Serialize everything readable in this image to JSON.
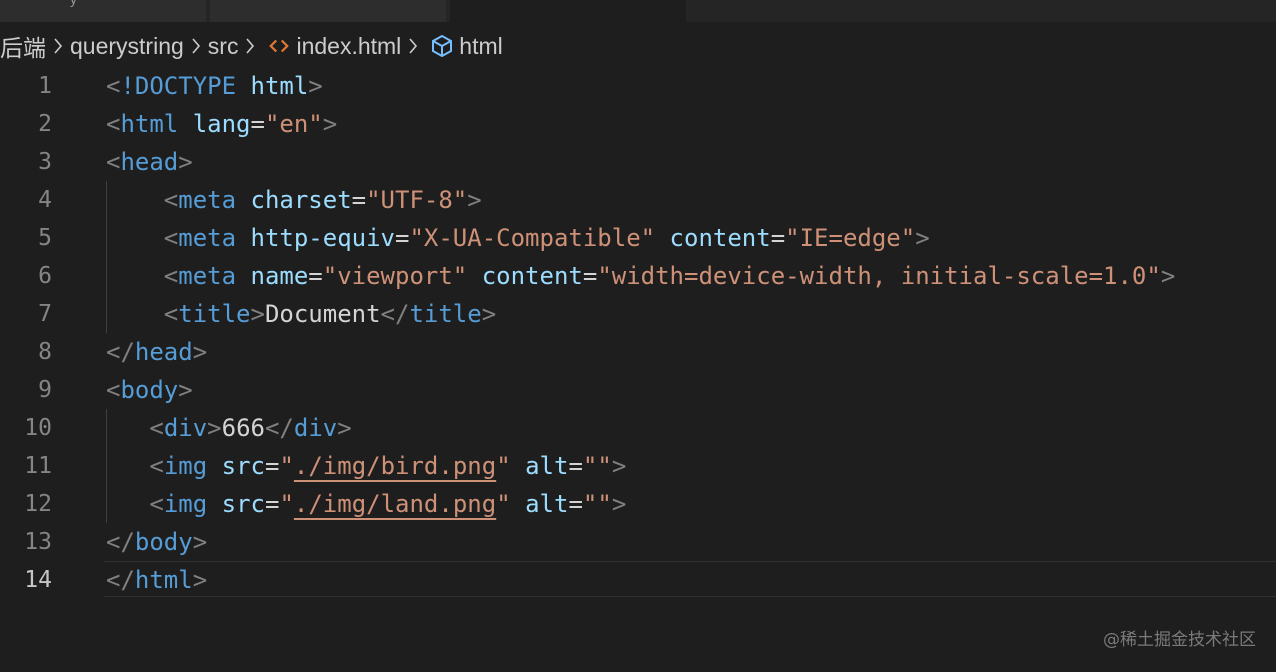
{
  "tabs": [
    {
      "label": "y"
    },
    {
      "label": ""
    },
    {
      "label": ""
    }
  ],
  "breadcrumb": {
    "items": [
      "后端",
      "querystring",
      "src",
      "index.html",
      "html"
    ],
    "file_icon": "html-file-icon",
    "symbol_icon": "symbol-cube-icon"
  },
  "colors": {
    "background": "#1e1e1e",
    "tag": "#569cd6",
    "punctuation": "#808080",
    "attribute": "#9cdcfe",
    "string": "#ce9178",
    "text": "#d4d4d4",
    "line_number": "#858585",
    "file_icon": "#e37933",
    "cube_icon": "#75beff"
  },
  "editor": {
    "active_line": 14,
    "lines": [
      {
        "n": "1",
        "tokens": [
          [
            "p",
            "<"
          ],
          [
            "t",
            "!DOCTYPE "
          ],
          [
            "a",
            "html"
          ],
          [
            "p",
            ">"
          ]
        ]
      },
      {
        "n": "2",
        "tokens": [
          [
            "p",
            "<"
          ],
          [
            "t",
            "html"
          ],
          [
            "tx",
            " "
          ],
          [
            "a",
            "lang"
          ],
          [
            "tx",
            "="
          ],
          [
            "s",
            "\"en\""
          ],
          [
            "p",
            ">"
          ]
        ]
      },
      {
        "n": "3",
        "tokens": [
          [
            "p",
            "<"
          ],
          [
            "t",
            "head"
          ],
          [
            "p",
            ">"
          ]
        ]
      },
      {
        "n": "4",
        "tokens": [
          [
            "tx",
            "    "
          ],
          [
            "p",
            "<"
          ],
          [
            "t",
            "meta"
          ],
          [
            "tx",
            " "
          ],
          [
            "a",
            "charset"
          ],
          [
            "tx",
            "="
          ],
          [
            "s",
            "\"UTF-8\""
          ],
          [
            "p",
            ">"
          ]
        ]
      },
      {
        "n": "5",
        "tokens": [
          [
            "tx",
            "    "
          ],
          [
            "p",
            "<"
          ],
          [
            "t",
            "meta"
          ],
          [
            "tx",
            " "
          ],
          [
            "a",
            "http-equiv"
          ],
          [
            "tx",
            "="
          ],
          [
            "s",
            "\"X-UA-Compatible\""
          ],
          [
            "tx",
            " "
          ],
          [
            "a",
            "content"
          ],
          [
            "tx",
            "="
          ],
          [
            "s",
            "\"IE=edge\""
          ],
          [
            "p",
            ">"
          ]
        ]
      },
      {
        "n": "6",
        "tokens": [
          [
            "tx",
            "    "
          ],
          [
            "p",
            "<"
          ],
          [
            "t",
            "meta"
          ],
          [
            "tx",
            " "
          ],
          [
            "a",
            "name"
          ],
          [
            "tx",
            "="
          ],
          [
            "s",
            "\"viewport\""
          ],
          [
            "tx",
            " "
          ],
          [
            "a",
            "content"
          ],
          [
            "tx",
            "="
          ],
          [
            "s",
            "\"width=device-width, initial-scale=1.0\""
          ],
          [
            "p",
            ">"
          ]
        ]
      },
      {
        "n": "7",
        "tokens": [
          [
            "tx",
            "    "
          ],
          [
            "p",
            "<"
          ],
          [
            "t",
            "title"
          ],
          [
            "p",
            ">"
          ],
          [
            "tx",
            "Document"
          ],
          [
            "p",
            "</"
          ],
          [
            "t",
            "title"
          ],
          [
            "p",
            ">"
          ]
        ]
      },
      {
        "n": "8",
        "tokens": [
          [
            "p",
            "</"
          ],
          [
            "t",
            "head"
          ],
          [
            "p",
            ">"
          ]
        ]
      },
      {
        "n": "9",
        "tokens": [
          [
            "p",
            "<"
          ],
          [
            "t",
            "body"
          ],
          [
            "p",
            ">"
          ]
        ]
      },
      {
        "n": "10",
        "tokens": [
          [
            "tx",
            "   "
          ],
          [
            "p",
            "<"
          ],
          [
            "t",
            "div"
          ],
          [
            "p",
            ">"
          ],
          [
            "tx",
            "666"
          ],
          [
            "p",
            "</"
          ],
          [
            "t",
            "div"
          ],
          [
            "p",
            ">"
          ]
        ]
      },
      {
        "n": "11",
        "tokens": [
          [
            "tx",
            "   "
          ],
          [
            "p",
            "<"
          ],
          [
            "t",
            "img"
          ],
          [
            "tx",
            " "
          ],
          [
            "a",
            "src"
          ],
          [
            "tx",
            "="
          ],
          [
            "s",
            "\""
          ],
          [
            "su",
            "./img/bird.png"
          ],
          [
            "s",
            "\""
          ],
          [
            "tx",
            " "
          ],
          [
            "a",
            "alt"
          ],
          [
            "tx",
            "="
          ],
          [
            "s",
            "\"\""
          ],
          [
            "p",
            ">"
          ]
        ]
      },
      {
        "n": "12",
        "tokens": [
          [
            "tx",
            "   "
          ],
          [
            "p",
            "<"
          ],
          [
            "t",
            "img"
          ],
          [
            "tx",
            " "
          ],
          [
            "a",
            "src"
          ],
          [
            "tx",
            "="
          ],
          [
            "s",
            "\""
          ],
          [
            "su",
            "./img/land.png"
          ],
          [
            "s",
            "\""
          ],
          [
            "tx",
            " "
          ],
          [
            "a",
            "alt"
          ],
          [
            "tx",
            "="
          ],
          [
            "s",
            "\"\""
          ],
          [
            "p",
            ">"
          ]
        ]
      },
      {
        "n": "13",
        "tokens": [
          [
            "p",
            "</"
          ],
          [
            "t",
            "body"
          ],
          [
            "p",
            ">"
          ]
        ]
      },
      {
        "n": "14",
        "tokens": [
          [
            "p",
            "</"
          ],
          [
            "t",
            "html"
          ],
          [
            "p",
            ">"
          ]
        ]
      }
    ]
  },
  "watermark": "@稀土掘金技术社区"
}
